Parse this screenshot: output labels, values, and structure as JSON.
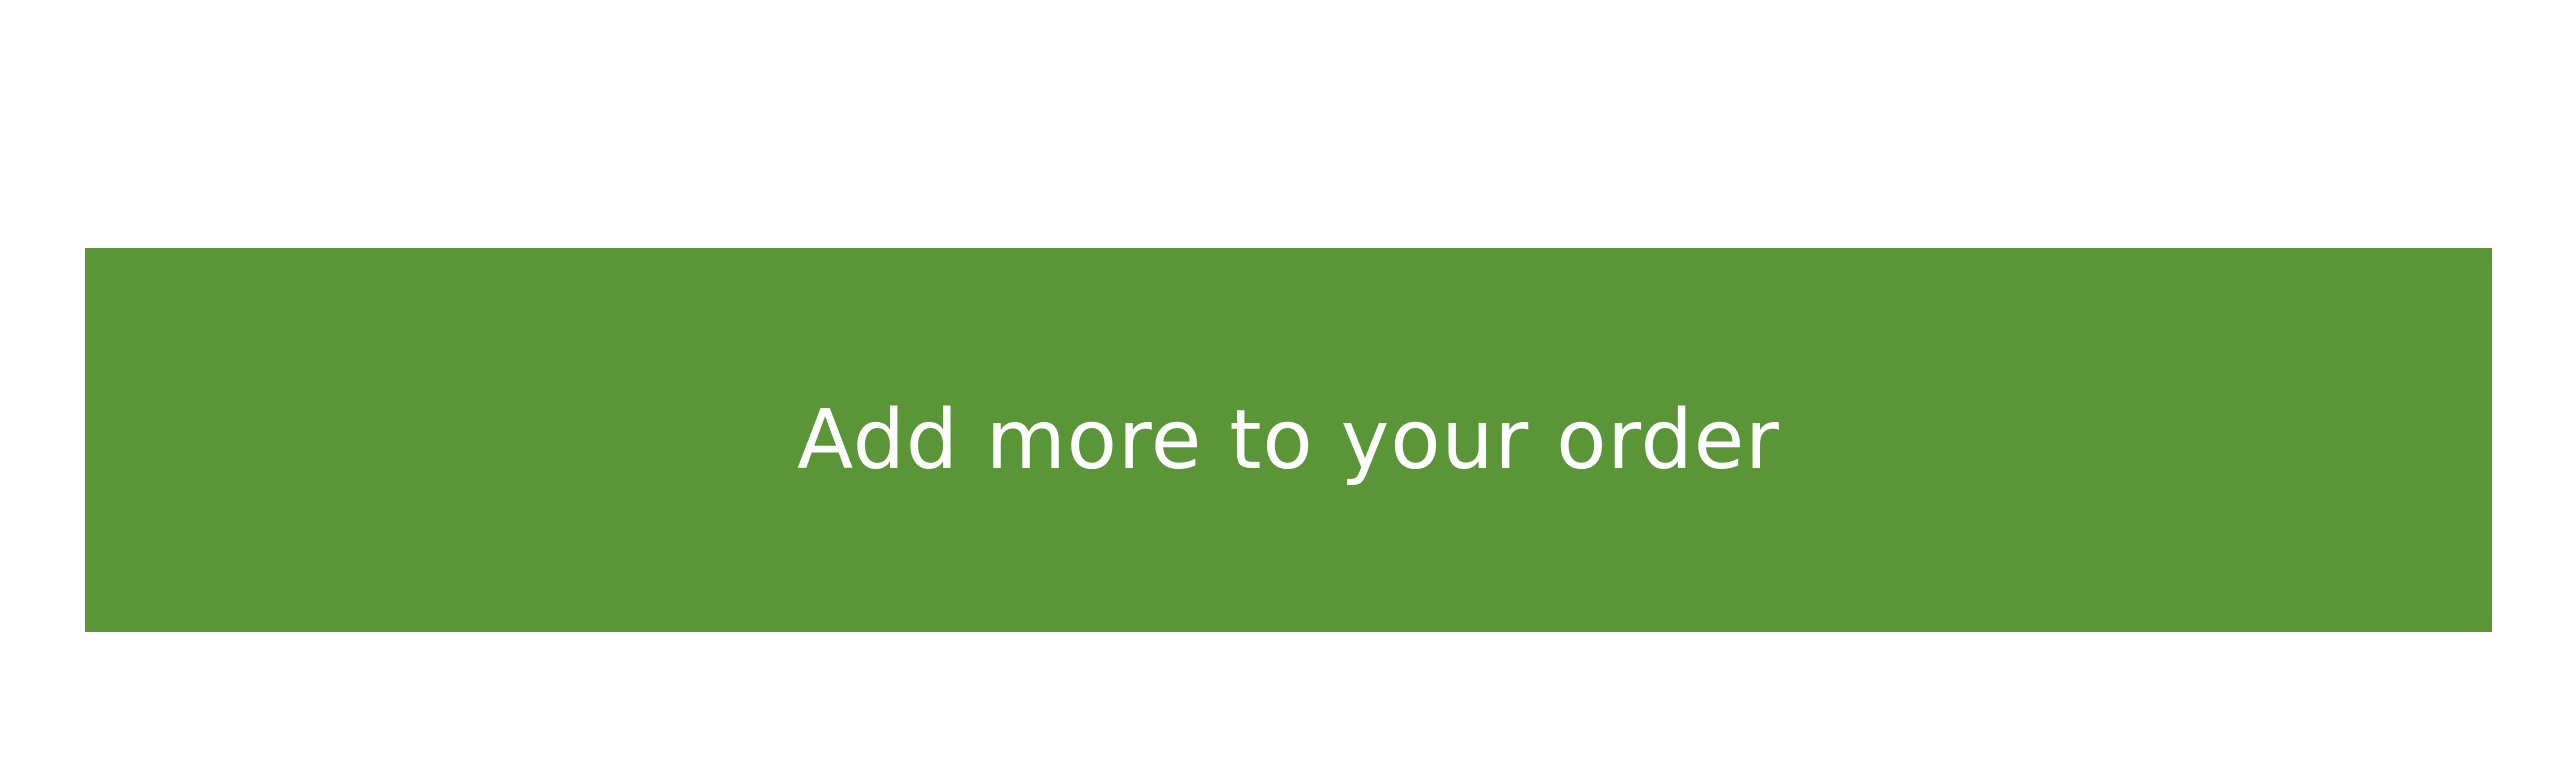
{
  "cta": {
    "label": "Add more to your order",
    "background_color": "#5a9637",
    "text_color": "#ffffff"
  }
}
